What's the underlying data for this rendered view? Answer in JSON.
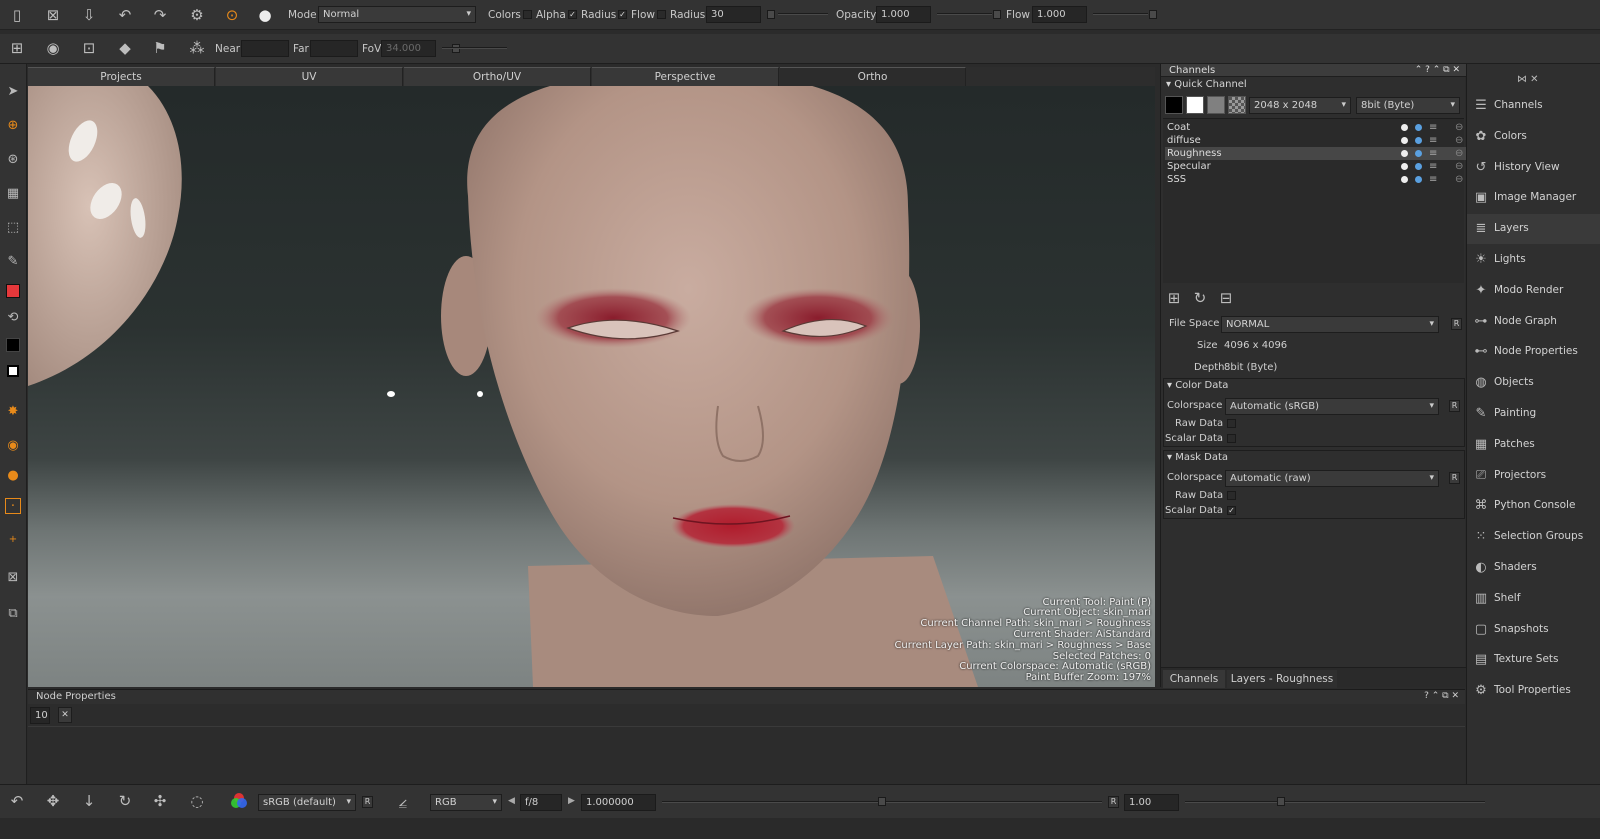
{
  "toolbar": {
    "mode_label": "Mode",
    "mode_value": "Normal",
    "colors_label": "Colors",
    "alpha_label": "Alpha",
    "alpha_checked": false,
    "radius_check_label": "Radius",
    "radius_checked": true,
    "flow_check_label": "Flow",
    "flow_checked": true,
    "radius_label": "Radius",
    "radius_value": "30",
    "opacity_label": "Opacity",
    "opacity_value": "1.000",
    "flow_label": "Flow",
    "flow_value": "1.000"
  },
  "camera_bar": {
    "near_label": "Near",
    "near_value": "",
    "far_label": "Far",
    "far_value": "",
    "fov_label": "FoV",
    "fov_value": "34.000"
  },
  "viewport_tabs": [
    "Projects",
    "UV",
    "Ortho/UV",
    "Perspective",
    "Ortho"
  ],
  "active_tab": "Ortho",
  "hud": [
    "Current Tool: Paint (P)",
    "Current Object: skin_mari",
    "Current Channel Path: skin_mari > Roughness",
    "Current Shader: AiStandard",
    "Current Layer Path: skin_mari > Roughness > Base",
    "Selected Patches: 0",
    "Current Colorspace: Automatic (sRGB)",
    "Paint Buffer Zoom: 197%"
  ],
  "channels_panel": {
    "title": "Channels",
    "quick_channel_label": "Quick Channel",
    "size_value": "2048 x 2048",
    "depth_value": "8bit  (Byte)",
    "channels": [
      "Coat",
      "diffuse",
      "Roughness",
      "Specular",
      "SSS"
    ],
    "selected_channel": "Roughness",
    "file_space_label": "File Space",
    "file_space_value": "NORMAL",
    "size_label": "Size",
    "size_prop_value": "4096 x 4096",
    "depth_label": "Depth",
    "depth_prop_value": "8bit  (Byte)",
    "color_data_label": "Color Data",
    "color_colorspace_label": "Colorspace",
    "color_colorspace_value": "Automatic (sRGB)",
    "color_raw_label": "Raw Data",
    "color_raw_checked": false,
    "color_scalar_label": "Scalar Data",
    "color_scalar_checked": false,
    "mask_data_label": "Mask Data",
    "mask_colorspace_label": "Colorspace",
    "mask_colorspace_value": "Automatic (raw)",
    "mask_raw_label": "Raw Data",
    "mask_raw_checked": false,
    "mask_scalar_label": "Scalar Data",
    "mask_scalar_checked": true,
    "r_label": "R",
    "bottom_tabs": [
      "Channels",
      "Layers - Roughness"
    ]
  },
  "right_nav": [
    {
      "label": "Channels",
      "icon": "channels-icon",
      "active": false
    },
    {
      "label": "Colors",
      "icon": "colors-icon",
      "active": false
    },
    {
      "label": "History View",
      "icon": "history-icon",
      "active": false
    },
    {
      "label": "Image Manager",
      "icon": "image-manager-icon",
      "active": false
    },
    {
      "label": "Layers",
      "icon": "layers-icon",
      "active": true
    },
    {
      "label": "Lights",
      "icon": "lights-icon",
      "active": false
    },
    {
      "label": "Modo Render",
      "icon": "modo-render-icon",
      "active": false
    },
    {
      "label": "Node Graph",
      "icon": "node-graph-icon",
      "active": false
    },
    {
      "label": "Node Properties",
      "icon": "node-properties-icon",
      "active": false
    },
    {
      "label": "Objects",
      "icon": "objects-icon",
      "active": false
    },
    {
      "label": "Painting",
      "icon": "painting-icon",
      "active": false
    },
    {
      "label": "Patches",
      "icon": "patches-icon",
      "active": false
    },
    {
      "label": "Projectors",
      "icon": "projectors-icon",
      "active": false
    },
    {
      "label": "Python Console",
      "icon": "python-console-icon",
      "active": false
    },
    {
      "label": "Selection Groups",
      "icon": "selection-groups-icon",
      "active": false
    },
    {
      "label": "Shaders",
      "icon": "shaders-icon",
      "active": false
    },
    {
      "label": "Shelf",
      "icon": "shelf-icon",
      "active": false
    },
    {
      "label": "Snapshots",
      "icon": "snapshots-icon",
      "active": false
    },
    {
      "label": "Texture Sets",
      "icon": "texture-sets-icon",
      "active": false
    },
    {
      "label": "Tool Properties",
      "icon": "tool-properties-icon",
      "active": false
    }
  ],
  "node_properties": {
    "title": "Node Properties",
    "history_value": "10"
  },
  "bottom_bar": {
    "colorspace_value": "sRGB (default)",
    "r_label": "R",
    "channel_value": "RGB",
    "fstop_value": "f/8",
    "exposure_value": "1.000000",
    "gain_r_label": "R",
    "gain_value": "1.00"
  },
  "colors": {
    "foreground": "#e5383b",
    "background": "#000000",
    "accent_orange": "#e88a1a"
  }
}
